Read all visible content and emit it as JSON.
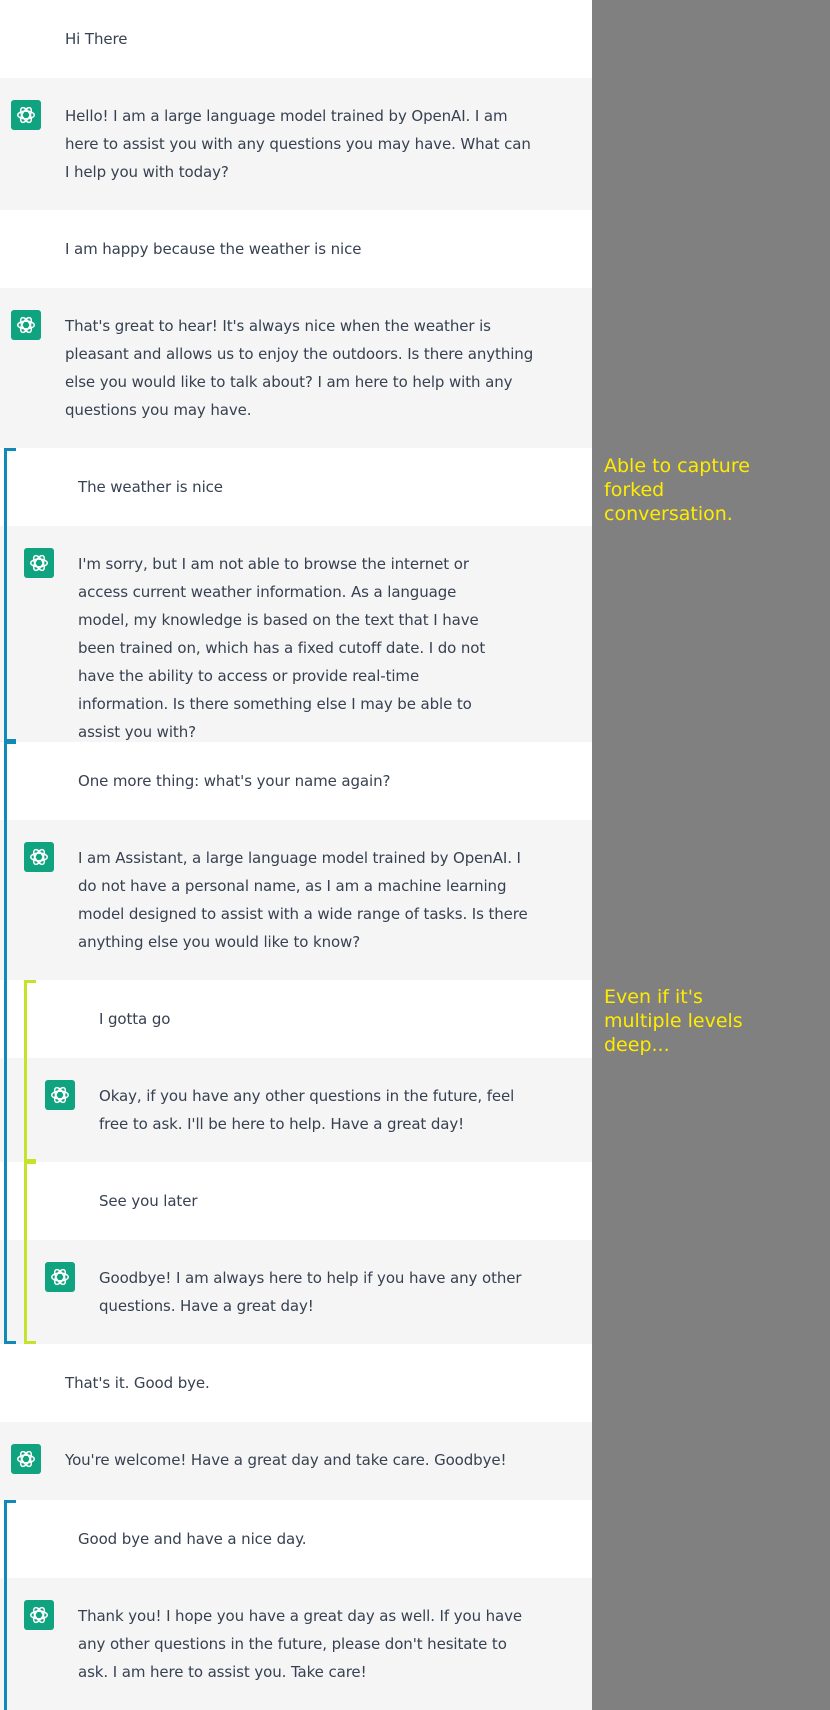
{
  "colors": {
    "side_panel": "#808080",
    "assistant_bg": "#f5f5f5",
    "user_bg": "#ffffff",
    "avatar": "#10a37f",
    "fork_level1": "#1289b8",
    "fork_level2": "#c6e22a",
    "annotation": "#ffec00"
  },
  "messages": [
    {
      "role": "user",
      "text": "Hi There"
    },
    {
      "role": "assistant",
      "icon": "openai-logo-icon",
      "text": "Hello! I am a large language model trained by OpenAI. I am here to assist you with any questions you may have. What can I help you with today?"
    },
    {
      "role": "user",
      "text": "I am happy because the weather is nice"
    },
    {
      "role": "assistant",
      "icon": "openai-logo-icon",
      "text": "That's great to hear! It's always nice when the weather is pleasant and allows us to enjoy the outdoors. Is there anything else you would like to talk about? I am here to help with any questions you may have."
    },
    {
      "role": "user",
      "text": "The weather is nice",
      "fork_level": 1
    },
    {
      "role": "assistant",
      "icon": "openai-logo-icon",
      "fork_level": 1,
      "text": "I'm sorry, but I am not able to browse the internet or access current weather information. As a language model, my knowledge is based on the text that I have been trained on, which has a fixed cutoff date. I do not have the ability to access or provide real-time information. Is there something else I may be able to assist you with?"
    },
    {
      "role": "user",
      "text": "One more thing: what's your name again?",
      "fork_level": 1
    },
    {
      "role": "assistant",
      "icon": "openai-logo-icon",
      "fork_level": 1,
      "text": "I am Assistant, a large language model trained by OpenAI. I do not have a personal name, as I am a machine learning model designed to assist with a wide range of tasks. Is there anything else you would like to know?"
    },
    {
      "role": "user",
      "text": "I gotta go",
      "fork_level": 2
    },
    {
      "role": "assistant",
      "icon": "openai-logo-icon",
      "fork_level": 2,
      "text": "Okay, if you have any other questions in the future, feel free to ask. I'll be here to help. Have a great day!"
    },
    {
      "role": "user",
      "text": "See you later",
      "fork_level": 2
    },
    {
      "role": "assistant",
      "icon": "openai-logo-icon",
      "fork_level": 2,
      "text": "Goodbye! I am always here to help if you have any other questions. Have a great day!"
    },
    {
      "role": "user",
      "text": "That's it. Good bye."
    },
    {
      "role": "assistant",
      "icon": "openai-logo-icon",
      "text": "You're welcome! Have a great day and take care. Goodbye!"
    },
    {
      "role": "user",
      "text": "Good bye and have a nice day.",
      "fork_level": 1
    },
    {
      "role": "assistant",
      "icon": "openai-logo-icon",
      "fork_level": 1,
      "text": "Thank you! I hope you have a great day as well. If you have any other questions in the future, please don't hesitate to ask. I am here to assist you. Take care!"
    }
  ],
  "annotations": {
    "forked": "Able to capture forked conversation.",
    "multilevel": "Even if it's multiple levels deep..."
  }
}
